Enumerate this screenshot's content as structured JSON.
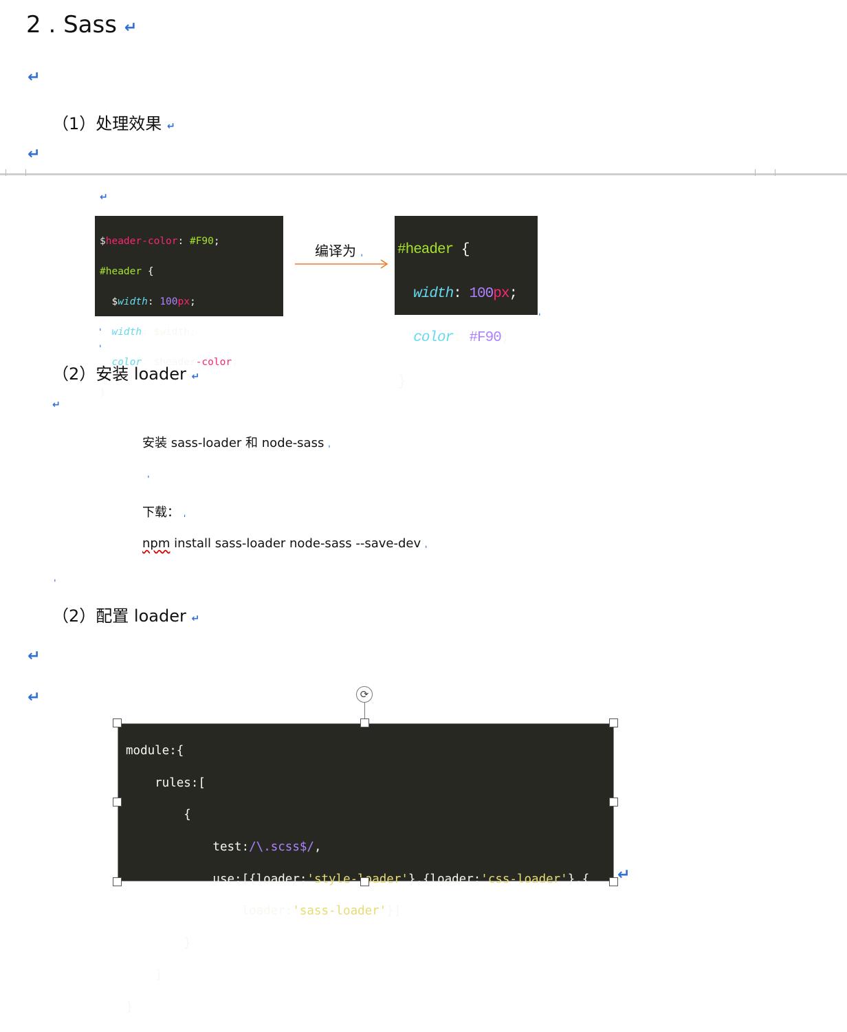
{
  "heading": {
    "number": "2",
    "sep": ".",
    "text": "Sass"
  },
  "sections": {
    "effect": {
      "label": "（1）处理效果"
    },
    "install": {
      "label": "（2）安装 loader"
    },
    "config": {
      "label": "（2）配置 loader"
    }
  },
  "compile_label": "编译为",
  "source_code": {
    "line1_a": "$",
    "line1_b": "header-color",
    "line1_c": ": ",
    "line1_d": "#F90",
    "line1_e": ";",
    "line2_a": "#header",
    "line2_b": " {",
    "line3_a": "  $",
    "line3_b": "width",
    "line3_c": ": ",
    "line3_d": "100",
    "line3_e": "px",
    "line3_f": ";",
    "line4_a": "  ",
    "line4_b": "width",
    "line4_c": ": $width;",
    "line5_a": "  ",
    "line5_b": "color",
    "line5_c": ": $header",
    "line5_d": "-color",
    "line5_e": ";",
    "line6": "}"
  },
  "output_code": {
    "line1_a": "#header",
    "line1_b": " {",
    "line2_a": "  ",
    "line2_b": "width",
    "line2_c": ": ",
    "line2_d": "100",
    "line2_e": "px",
    "line2_f": ";",
    "line3_a": "  ",
    "line3_b": "color",
    "line3_c": ": ",
    "line3_d": "#F90",
    "line3_e": ";",
    "line4": "}"
  },
  "install_text": {
    "line1": "安装 sass-loader 和 node-sass",
    "line2": "下载：",
    "line3_a": "npm",
    "line3_b": " install sass-loader node-sass --save-dev"
  },
  "config_code": {
    "l1": "module:{",
    "l2": "    rules:[",
    "l3": "        {",
    "l4_a": "            test:",
    "l4_b": "/\\.scss$/",
    "l4_c": ",",
    "l5_a": "            use:[{loader:",
    "l5_b": "'style-loader'",
    "l5_c": "},{loader:",
    "l5_d": "'css-loader'",
    "l5_e": "},{",
    "l6_a": "                loader:",
    "l6_b": "'sass-loader'",
    "l6_c": "}]",
    "l7": "        }",
    "l8": "    ]",
    "l9": "}"
  }
}
